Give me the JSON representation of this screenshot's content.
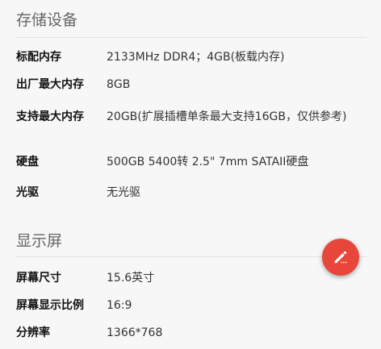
{
  "storage": {
    "title": "存储设备",
    "rows": [
      {
        "label": "标配内存",
        "value": "2133MHz DDR4；4GB(板载内存)"
      },
      {
        "label": "出厂最大内存",
        "value": "8GB"
      },
      {
        "label": "支持最大内存",
        "value": "20GB(扩展插槽单条最大支持16GB，仅供参考)"
      },
      {
        "label": "硬盘",
        "value": "500GB 5400转 2.5\" 7mm SATAII硬盘"
      },
      {
        "label": "光驱",
        "value": "无光驱"
      }
    ]
  },
  "display": {
    "title": "显示屏",
    "rows": [
      {
        "label": "屏幕尺寸",
        "value": "15.6英寸"
      },
      {
        "label": "屏幕显示比例",
        "value": "16:9"
      },
      {
        "label": "分辨率",
        "value": "1366*768"
      }
    ]
  },
  "fab": {
    "icon": "edit-icon",
    "color": "#e8463a"
  }
}
